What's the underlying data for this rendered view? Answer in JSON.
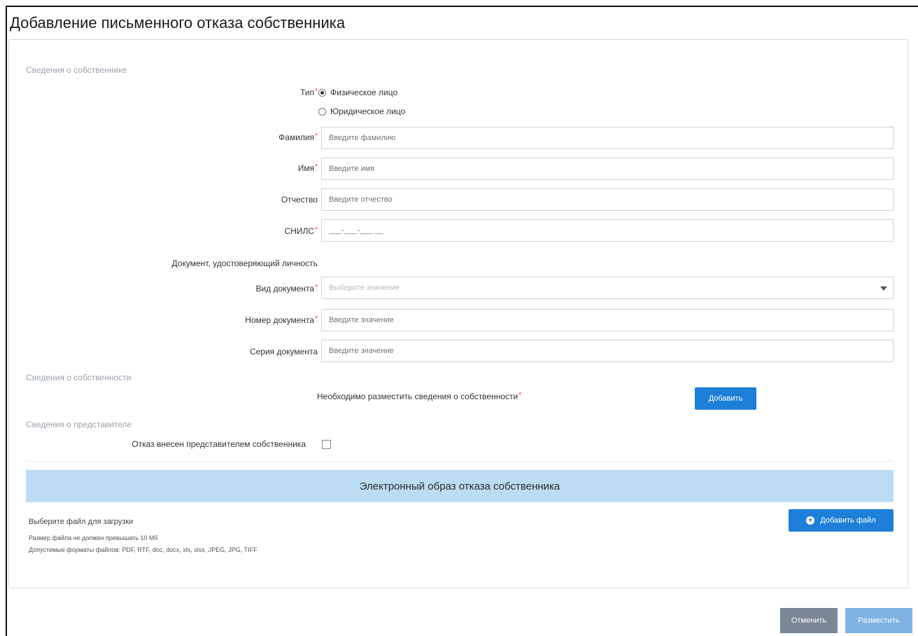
{
  "page_title": "Добавление письменного отказа собственника",
  "owner_section": {
    "heading": "Сведения о собственнике",
    "type_label": "Тип",
    "type_options": [
      "Физическое лицо",
      "Юридическое лицо"
    ],
    "type_selected": "Физическое лицо",
    "surname": {
      "label": "Фамилия",
      "placeholder": "Введите фамилию",
      "value": ""
    },
    "name": {
      "label": "Имя",
      "placeholder": "Введите имя",
      "value": ""
    },
    "patronymic": {
      "label": "Отчество",
      "placeholder": "Введите отчество",
      "value": ""
    },
    "snils": {
      "label": "СНИЛС",
      "placeholder": "___-___-___ __",
      "value": ""
    },
    "id_doc_heading": "Документ, удостоверяющий личность",
    "doc_type": {
      "label": "Вид документа",
      "placeholder": "Выберите значение"
    },
    "doc_number": {
      "label": "Номер документа",
      "placeholder": "Введите значение",
      "value": ""
    },
    "doc_series": {
      "label": "Серия документа",
      "placeholder": "Введите значение",
      "value": ""
    }
  },
  "property_section": {
    "heading": "Сведения о собственности",
    "required_text": "Необходимо разместить сведения о собственности",
    "add_button": "Добавить"
  },
  "representative_section": {
    "heading": "Сведения о представителе",
    "checkbox_label": "Отказ внесен представителем собственника",
    "checked": false
  },
  "upload_section": {
    "banner": "Электронный образ отказа собственника",
    "choose_text": "Выберите файл для загрузки",
    "size_note": "Размер файла не должен превышать 10 Мб",
    "formats_note": "Допустимые форматы файлов: PDF, RTF, doc, docx, xls, xlsx, JPEG, JPG, TIFF",
    "add_file_button": "Добавить файл"
  },
  "footer": {
    "cancel_button": "Отменить",
    "submit_button": "Разместить"
  },
  "colors": {
    "primary": "#1e7fd8",
    "banner_bg": "#bcdcf3",
    "required": "#e53935"
  }
}
